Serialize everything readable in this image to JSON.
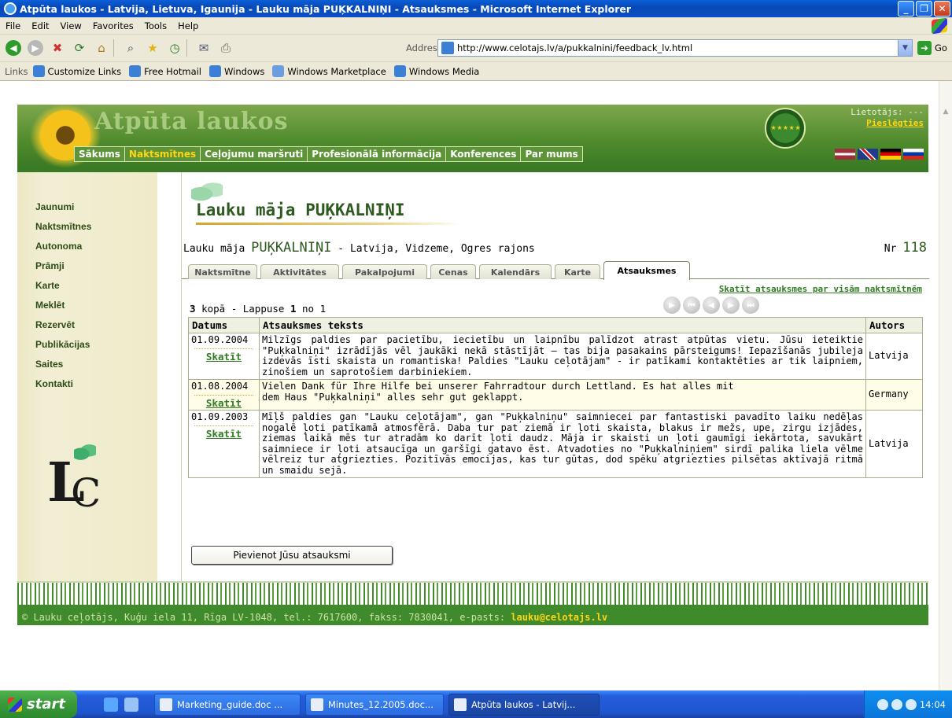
{
  "window": {
    "title": "Atpūta laukos - Latvija, Lietuva, Igaunija - Lauku māja PUĶKALNIŅI - Atsauksmes - Microsoft Internet Explorer",
    "minimize": "_",
    "maximize": "❐",
    "close": "✕"
  },
  "menubar": [
    "File",
    "Edit",
    "View",
    "Favorites",
    "Tools",
    "Help"
  ],
  "toolbar": {
    "address_label": "Address",
    "url": "http://www.celotajs.lv/a/pukkalnini/feedback_lv.html",
    "go_label": "Go"
  },
  "linksbar": {
    "label": "Links",
    "items": [
      "Customize Links",
      "Free Hotmail",
      "Windows",
      "Windows Marketplace",
      "Windows Media"
    ]
  },
  "site": {
    "logo": "Atpūta laukos",
    "nav": [
      "Sākums",
      "Naktsmītnes",
      "Ceļojumu maršruti",
      "Profesionālā informācija",
      "Konferences",
      "Par mums"
    ],
    "active_nav": "Naktsmītnes",
    "user_label": "Lietotājs: ---",
    "login": "Pieslēgties"
  },
  "sidebar": [
    "Jaunumi",
    "Naktsmītnes",
    "Autonoma",
    "Prāmji",
    "Karte",
    "Meklēt",
    "Rezervēt",
    "Publikācijas",
    "Saites",
    "Kontakti"
  ],
  "house": {
    "title": "Lauku māja PUĶKALNIŅI",
    "loc_prefix": "Lauku māja",
    "name": "PUĶKALNIŅI",
    "location": "- Latvija,  Vidzeme,  Ogres rajons",
    "nr_label": "Nr",
    "nr": "118"
  },
  "tabs": [
    "Naktsmītne",
    "Aktivitātes",
    "Pakalpojumi",
    "Cenas",
    "Kalendārs",
    "Karte",
    "Atsauksmes"
  ],
  "active_tab": "Atsauksmes",
  "feedback": {
    "all_link": "Skatīt atsauksmes par visām naktsmītnēm",
    "count": "3",
    "count_suffix": "kopā - Lappuse",
    "page": "1",
    "page_of": "no 1",
    "headers": {
      "date": "Datums",
      "text": "Atsauksmes teksts",
      "author": "Autors"
    },
    "view_label": "Skatīt",
    "rows": [
      {
        "date": "01.09.2004",
        "text": "Milzīgs paldies par pacietību, iecietību un laipnību palīdzot atrast atpūtas vietu. Jūsu ieteiktie \"Puķkalniņi\" izrādījās vēl jaukāki nekā stāstījāt – tas bija pasakains pārsteigums! Iepazīšanās jubileja izdevās īsti skaista un romantiska! Paldies \"Lauku ceļotājam\" - ir patīkami kontaktēties ar tik laipniem, zinošiem un saprotošiem darbiniekiem.",
        "author": "Latvija"
      },
      {
        "date": "01.08.2004",
        "text": "Vielen Dank für Ihre Hilfe bei unserer Fahrradtour durch Lettland. Es hat alles mit dem Haus \"Puķkalniņi\" alles sehr gut geklappt.",
        "author": "Germany"
      },
      {
        "date": "01.09.2003",
        "text": "Mīļš paldies gan \"Lauku ceļotājam\", gan \"Puķkalniņu\" saimniecei par fantastiski pavadīto laiku nedēļas nogalē ļoti patīkamā atmosfērā. Daba tur pat ziemā ir ļoti skaista, blakus ir mežs, upe, zirgu izjādes, ziemas laikā mēs tur atradām ko darīt ļoti daudz. Māja ir skaisti un ļoti gaumīgi iekārtota, savukārt saimniece ir ļoti atsaucīga un garšīgi gatavo ēst. Atvadoties no \"Puķkalniņiem\" sirdī palika liela vēlme vēlreiz tur atgriezties. Pozitīvās emocijas, kas tur gūtas, dod spēku atgriezties pilsētas aktīvajā ritmā un smaidu sejā.",
        "author": "Latvija"
      }
    ],
    "add_button": "Pievienot Jūsu atsauksmi"
  },
  "footer": {
    "text": "© Lauku ceļotājs, Kuģu iela 11, Rīga LV-1048, tel.: 7617600, fakss: 7830041, e-pasts: ",
    "email": "lauku@celotajs.lv"
  },
  "taskbar": {
    "start": "start",
    "tasks": [
      "Marketing_guide.doc ...",
      "Minutes_12.2005.doc...",
      "Atpūta laukos - Latvij..."
    ],
    "time": "14:04"
  }
}
